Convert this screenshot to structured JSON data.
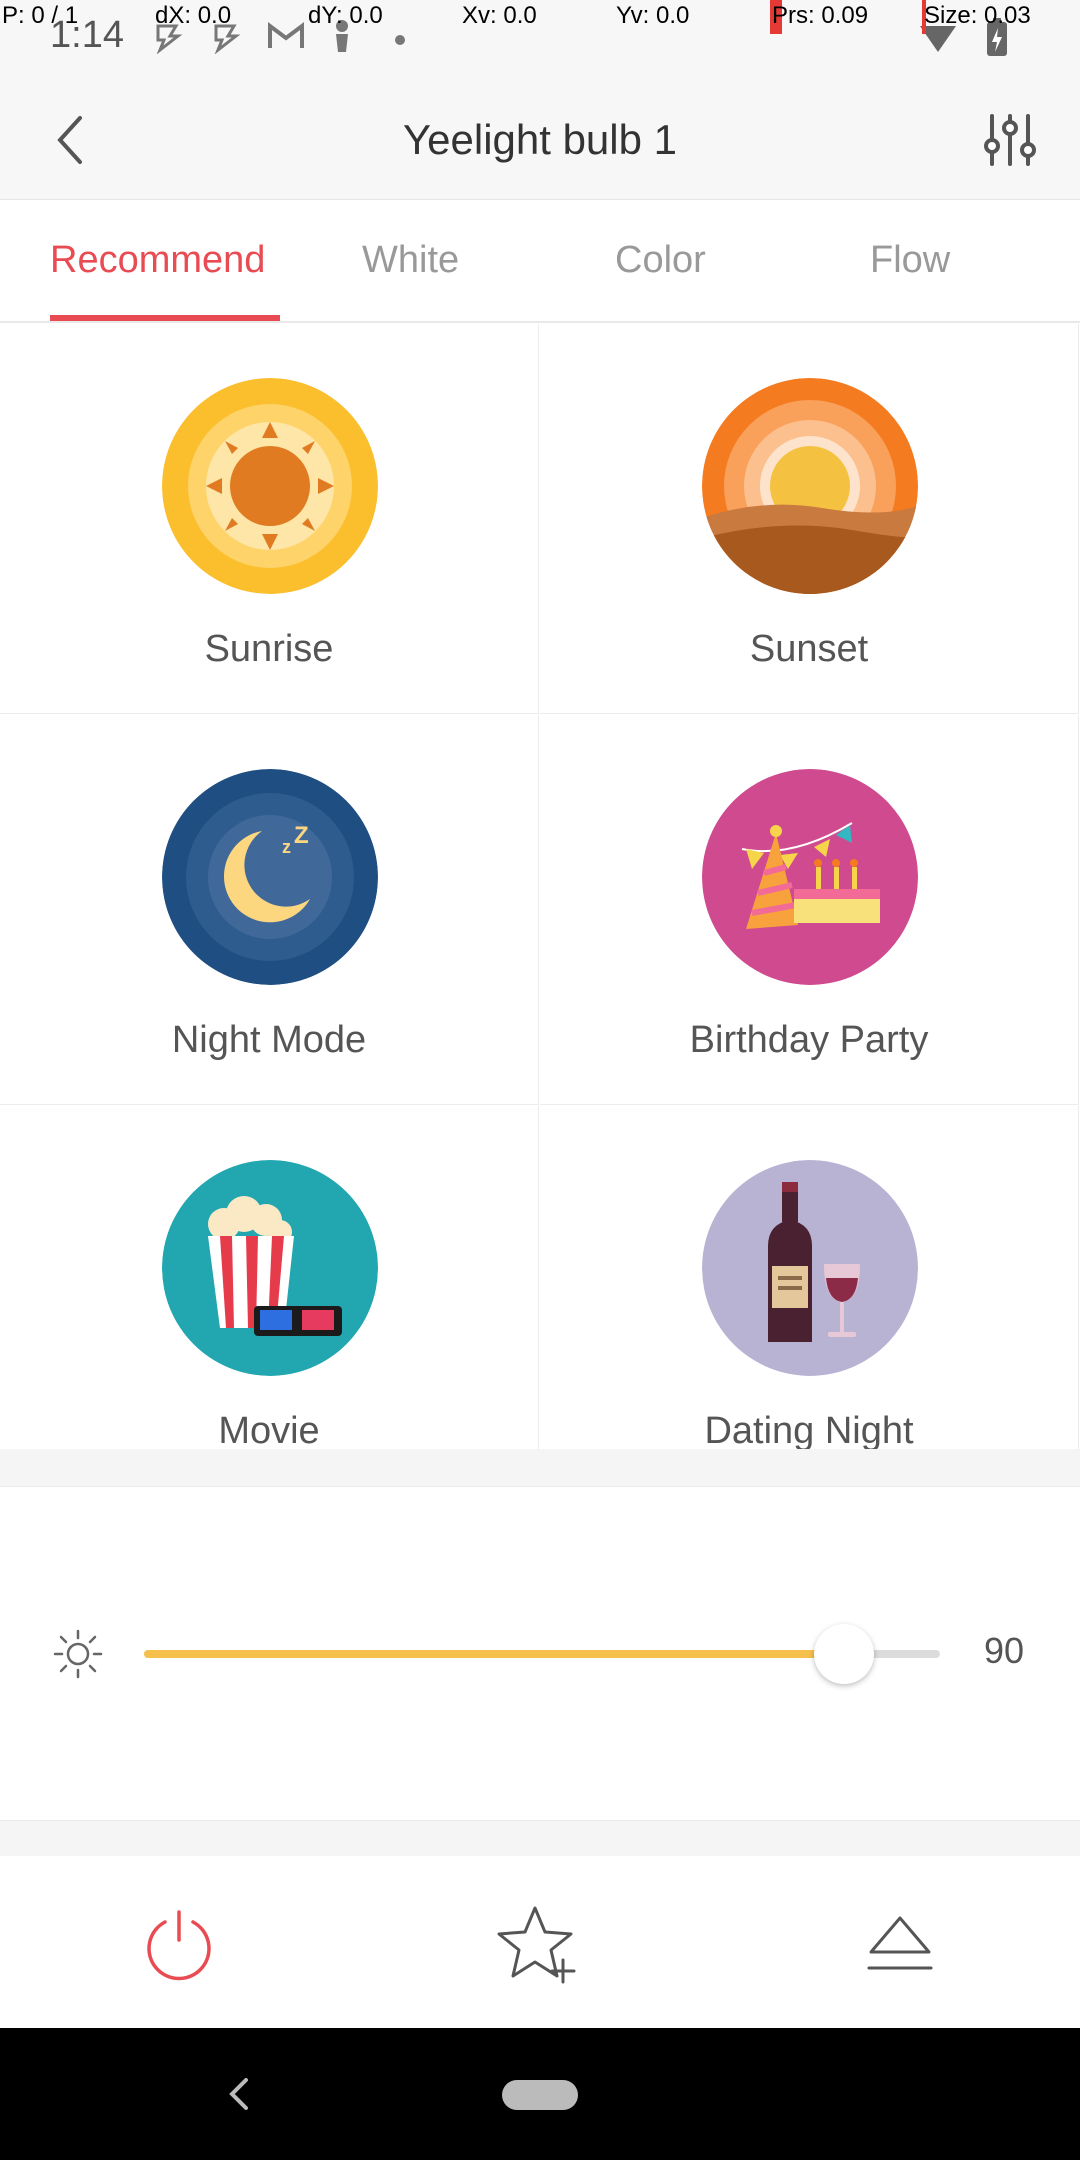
{
  "debug_overlay": {
    "p": "P: 0 / 1",
    "dx": "dX: 0.0",
    "dy": "dY: 0.0",
    "xv": "Xv: 0.0",
    "yv": "Yv: 0.0",
    "prs": "Prs: 0.09",
    "size": "Size: 0.03"
  },
  "status_bar": {
    "time": "1:14"
  },
  "header": {
    "title": "Yeelight bulb 1"
  },
  "tabs": [
    {
      "label": "Recommend",
      "active": true
    },
    {
      "label": "White",
      "active": false
    },
    {
      "label": "Color",
      "active": false
    },
    {
      "label": "Flow",
      "active": false
    }
  ],
  "scenes": [
    {
      "label": "Sunrise",
      "icon": "sunrise-icon"
    },
    {
      "label": "Sunset",
      "icon": "sunset-icon"
    },
    {
      "label": "Night Mode",
      "icon": "night-mode-icon"
    },
    {
      "label": "Birthday Party",
      "icon": "birthday-party-icon"
    },
    {
      "label": "Movie",
      "icon": "movie-icon"
    },
    {
      "label": "Dating Night",
      "icon": "dating-night-icon"
    }
  ],
  "brightness": {
    "value": "90",
    "level_fraction": 0.88,
    "icon": "brightness-icon"
  },
  "actions": [
    {
      "name": "power-button",
      "icon": "power-icon"
    },
    {
      "name": "add-favorite-button",
      "icon": "star-plus-icon"
    },
    {
      "name": "eject-button",
      "icon": "eject-icon"
    }
  ],
  "colors": {
    "accent": "#e94b53",
    "slider_fill": "#f6c04d",
    "header_bg": "#f7f7f7"
  }
}
